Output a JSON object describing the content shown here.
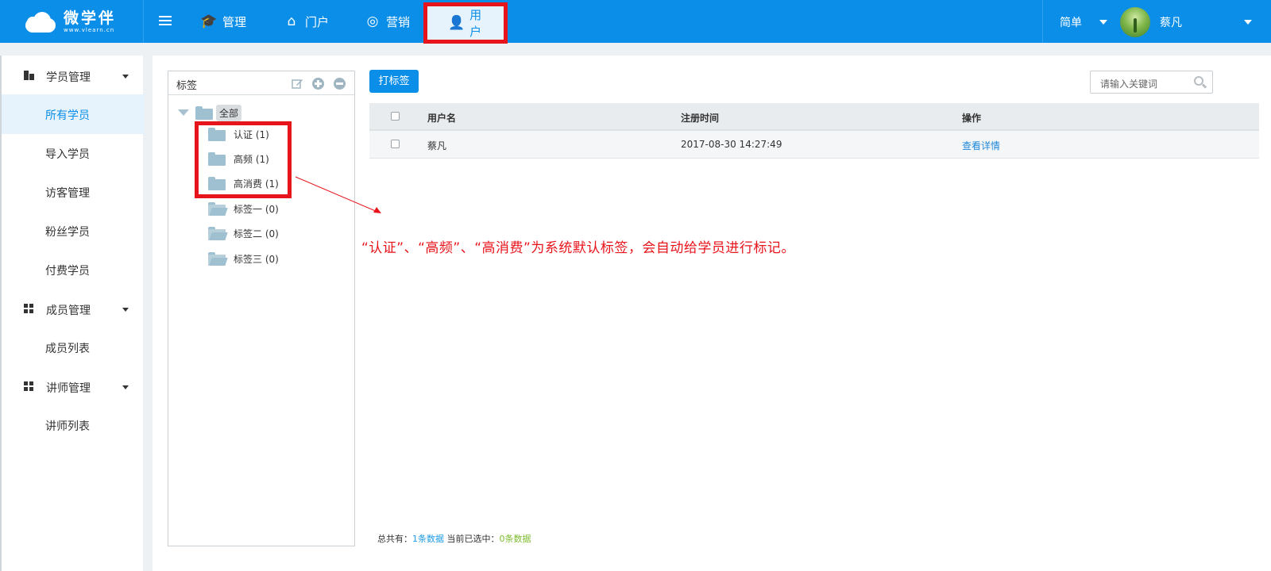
{
  "brand": {
    "name": "微学伴",
    "url": "www.vlearn.cn"
  },
  "topnav": {
    "items": [
      {
        "label": "管理",
        "icon": "graduation-cap-icon"
      },
      {
        "label": "门户",
        "icon": "home-icon"
      },
      {
        "label": "营销",
        "icon": "aperture-icon"
      },
      {
        "label": "用户",
        "icon": "user-gear-icon",
        "active": true
      }
    ],
    "version": "简单",
    "user": "蔡凡"
  },
  "sidebar": {
    "groups": [
      {
        "label": "学员管理",
        "items": [
          "所有学员",
          "导入学员",
          "访客管理",
          "粉丝学员",
          "付费学员"
        ]
      },
      {
        "label": "成员管理",
        "items": [
          "成员列表"
        ]
      },
      {
        "label": "讲师管理",
        "items": [
          "讲师列表"
        ]
      }
    ],
    "active_item": "所有学员"
  },
  "tagpanel": {
    "title": "标签",
    "root": "全部",
    "nodes": [
      {
        "label": "认证",
        "count": "(1)"
      },
      {
        "label": "高频",
        "count": "(1)"
      },
      {
        "label": "高消费",
        "count": "(1)"
      },
      {
        "label": "标签一",
        "count": "(0)"
      },
      {
        "label": "标签二",
        "count": "(0)"
      },
      {
        "label": "标签三",
        "count": "(0)"
      }
    ]
  },
  "toolbar": {
    "tag_button": "打标签",
    "search_placeholder": "请输入关键词"
  },
  "table": {
    "columns": [
      "用户名",
      "注册时间",
      "操作"
    ],
    "rows": [
      {
        "username": "蔡凡",
        "registered": "2017-08-30 14:27:49",
        "action": "查看详情"
      }
    ]
  },
  "footer": {
    "total_label": "总共有：",
    "total_value": "1条数据",
    "selected_label": "当前已选中：",
    "selected_value": "0条数据"
  },
  "annotation": "“认证”、“高频”、“高消费”为系统默认标签，会自动给学员进行标记。",
  "colors": {
    "primary": "#0b8ee8",
    "highlight": "#e8141b",
    "green": "#7cbb2e"
  }
}
